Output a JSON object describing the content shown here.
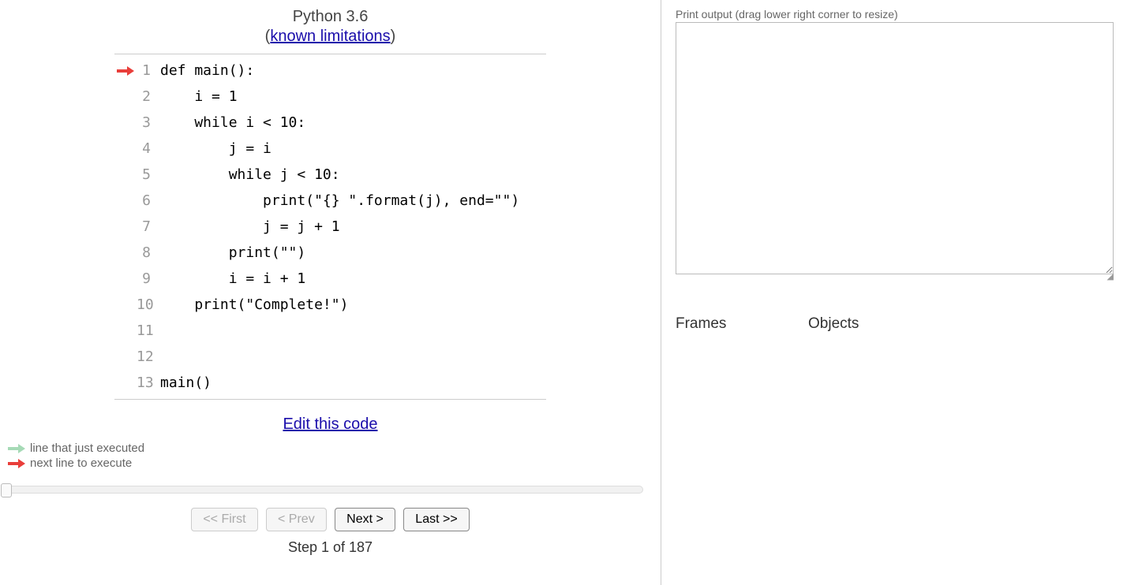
{
  "header": {
    "title": "Python 3.6",
    "limitations_link": "known limitations"
  },
  "code": {
    "current_arrow_line": 1,
    "lines": [
      {
        "num": 1,
        "text": "def main():"
      },
      {
        "num": 2,
        "text": "    i = 1"
      },
      {
        "num": 3,
        "text": "    while i < 10:"
      },
      {
        "num": 4,
        "text": "        j = i"
      },
      {
        "num": 5,
        "text": "        while j < 10:"
      },
      {
        "num": 6,
        "text": "            print(\"{} \".format(j), end=\"\")"
      },
      {
        "num": 7,
        "text": "            j = j + 1"
      },
      {
        "num": 8,
        "text": "        print(\"\")"
      },
      {
        "num": 9,
        "text": "        i = i + 1"
      },
      {
        "num": 10,
        "text": "    print(\"Complete!\")"
      },
      {
        "num": 11,
        "text": ""
      },
      {
        "num": 12,
        "text": ""
      },
      {
        "num": 13,
        "text": "main()"
      }
    ]
  },
  "edit_link": "Edit this code",
  "legend": {
    "just_executed": "line that just executed",
    "next_line": "next line to execute"
  },
  "nav": {
    "first": "<< First",
    "prev": "< Prev",
    "next": "Next >",
    "last": "Last >>"
  },
  "step": {
    "current": 1,
    "total": 187,
    "label_template": "Step {current} of {total}"
  },
  "output": {
    "label": "Print output (drag lower right corner to resize)",
    "content": ""
  },
  "vis": {
    "frames_label": "Frames",
    "objects_label": "Objects"
  },
  "colors": {
    "arrow_next": "#e93e3a",
    "arrow_prev": "#a6dab6"
  }
}
